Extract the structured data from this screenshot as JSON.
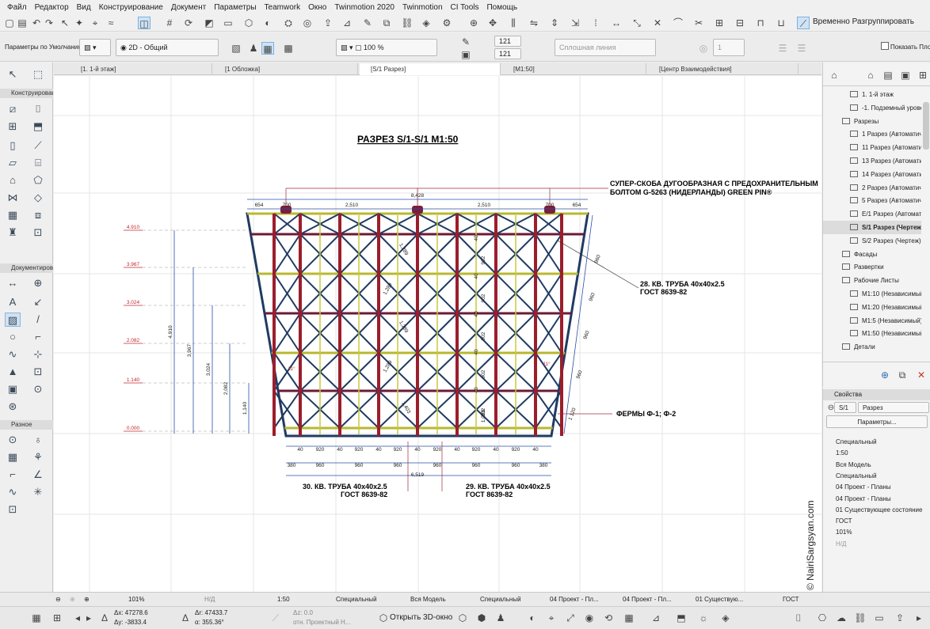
{
  "menu": [
    "Файл",
    "Редактор",
    "Вид",
    "Конструирование",
    "Документ",
    "Параметры",
    "Teamwork",
    "Окно",
    "Twinmotion 2020",
    "Twinmotion",
    "CI Tools",
    "Помощь"
  ],
  "toolbar": {
    "regroup_label": "Временно Разгруппировать",
    "show_label": "Показать Пло",
    "defaults_label": "Параметры по Умолчанию",
    "view_2d_label": "2D - Общий",
    "pen_value_1": "121",
    "pen_value_2": "121",
    "scale_pct": "100 %",
    "line_type": "Сплошная линия",
    "layer_num": "1"
  },
  "tabs": [
    {
      "label": "[1. 1-й этаж]"
    },
    {
      "label": "[1 Обложка]"
    },
    {
      "label": "[S/1 Разрез]"
    },
    {
      "label": "[M1:50]"
    },
    {
      "label": "[Центр Взаимодействия]"
    }
  ],
  "toolbox": {
    "section_construct": "Конструирование",
    "section_document": "Документирование",
    "section_other": "Разное"
  },
  "drawing": {
    "title": "РАЗРЕЗ   S/1-S/1   M1:50",
    "note_top_1": "СУПЕР-СКОБА  ДУГООБРАЗНАЯ С ПРЕДОХРАНИТЕЛЬНЫМ",
    "note_top_2": "БОЛТОМ G-5263 (НИДЕРЛАНДЫ) GREEN PIN®",
    "note_28_1": "28. КВ. ТРУБА 40х40х2.5",
    "note_28_2": "ГОСТ 8639-82",
    "note_farms": "ФЕРМЫ Ф-1; Ф-2",
    "note_30_1": "30. КВ. ТРУБА 40х40х2.5",
    "note_30_2": "ГОСТ 8639-82",
    "note_29_1": "29. КВ. ТРУБА 40х40х2.5",
    "note_29_2": "ГОСТ 8639-82",
    "levels": [
      "4.910",
      "3.967",
      "3.024",
      "2.082",
      "1.140",
      "0.000"
    ],
    "vdims": [
      "4,910",
      "3,967",
      "3,024",
      "2,082",
      "1,140"
    ],
    "top_dims": [
      "654",
      "700",
      "2,510",
      "2,510",
      "700",
      "654"
    ],
    "top_total": "8,428",
    "bottom_dims_a": [
      "40",
      "920",
      "40",
      "920",
      "40",
      "920",
      "40",
      "920",
      "40",
      "920",
      "40",
      "920",
      "40"
    ],
    "bottom_dims_b": [
      "380",
      "960",
      "960",
      "960",
      "960",
      "960",
      "960",
      "380"
    ],
    "bottom_total": "6,519",
    "inner_902": [
      "902",
      "902",
      "902",
      "902",
      "902"
    ],
    "bay_40": [
      "40",
      "40",
      "40",
      "40",
      "40"
    ],
    "diag_dims": [
      "1,289",
      "1,289",
      "1,289",
      "1,289",
      "1,403"
    ],
    "side_960": [
      "960",
      "960",
      "960",
      "960"
    ],
    "side_1120": "1 120",
    "dim_1059": "1,059",
    "angle_label": "11°",
    "watermark": "© NairiSargsyan.com"
  },
  "navigator": {
    "items": [
      {
        "label": "1. 1-й этаж",
        "indent": 2
      },
      {
        "label": "-1. Подземный уровень",
        "indent": 2
      },
      {
        "label": "Разрезы",
        "indent": 1,
        "folder": true
      },
      {
        "label": "1 Разрез (Автоматич",
        "indent": 2
      },
      {
        "label": "11 Разрез (Автомати",
        "indent": 2
      },
      {
        "label": "13 Разрез (Автомати",
        "indent": 2
      },
      {
        "label": "14 Разрез (Автомати",
        "indent": 2
      },
      {
        "label": "2 Разрез (Автоматиче",
        "indent": 2
      },
      {
        "label": "5 Разрез (Автоматиче",
        "indent": 2
      },
      {
        "label": "Е/1 Разрез (Автомати",
        "indent": 2
      },
      {
        "label": "S/1 Разрез (Чертеж)",
        "indent": 2,
        "selected": true
      },
      {
        "label": "S/2 Разрез (Чертеж)",
        "indent": 2
      },
      {
        "label": "Фасады",
        "indent": 1
      },
      {
        "label": "Развертки",
        "indent": 1
      },
      {
        "label": "Рабочие Листы",
        "indent": 1,
        "folder": true
      },
      {
        "label": "M1:10 (Независимый)",
        "indent": 2
      },
      {
        "label": "M1:20 (Независимый)",
        "indent": 2
      },
      {
        "label": "M1:5 (Независимый)",
        "indent": 2
      },
      {
        "label": "M1:50 (Независимый)",
        "indent": 2
      },
      {
        "label": "Детали",
        "indent": 1
      }
    ]
  },
  "properties": {
    "header": "Свойства",
    "id": "S/1",
    "name": "Разрез",
    "params_button": "Параметры...",
    "rows": [
      "Специальный",
      "1:50",
      "Вся Модель",
      "Специальный",
      "04 Проект - Планы",
      "04 Проект - Планы",
      "01 Существующее состояние",
      "ГОСТ",
      "101%",
      "Н/Д"
    ]
  },
  "statusbar": {
    "zoom": "101%",
    "angle": "Н/Д",
    "scale": "1:50",
    "layer_set": "Специальный",
    "model": "Вся Модель",
    "special": "Специальный",
    "proj1": "04 Проект - Пл...",
    "proj2": "04 Проект - Пл...",
    "existing": "01 Существую...",
    "gost": "ГОСТ"
  },
  "coords": {
    "dx": "Δx: 47278.6",
    "dy": "Δy: -3833.4",
    "dr": "Δr: 47433.7",
    "da": "α: 355.36°",
    "dz": "Δz: 0.0",
    "ref": "отн. Проектный Н...",
    "open3d": "Открыть 3D-окно"
  }
}
